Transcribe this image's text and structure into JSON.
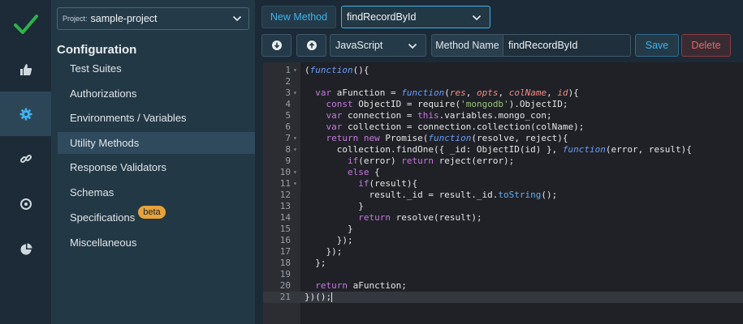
{
  "project": {
    "label": "Project:",
    "value": "sample-project"
  },
  "nav": {
    "title": "Configuration",
    "items": [
      {
        "label": "Test Suites"
      },
      {
        "label": "Authorizations"
      },
      {
        "label": "Environments / Variables"
      },
      {
        "label": "Utility Methods",
        "active": true
      },
      {
        "label": "Response Validators"
      },
      {
        "label": "Schemas"
      },
      {
        "label": "Specifications",
        "badge": "beta"
      },
      {
        "label": "Miscellaneous"
      }
    ]
  },
  "rail": {
    "icons": [
      "checkmark-icon",
      "thumbs-up-icon",
      "gear-icon",
      "link-icon",
      "target-icon",
      "pie-chart-icon"
    ],
    "active": "gear-icon",
    "accent": "#2fb34a"
  },
  "toolbar": {
    "new_method_label": "New Method",
    "method_select_value": "findRecordById",
    "language_value": "JavaScript",
    "method_name_label": "Method Name",
    "method_name_value": "findRecordById",
    "save_label": "Save",
    "delete_label": "Delete"
  },
  "editor": {
    "active_line": 21,
    "lines": [
      "(function(){",
      "",
      "  var aFunction = function(res, opts, colName, id){",
      "    const ObjectID = require('mongodb').ObjectID;",
      "    var connection = this.variables.mongo_con;",
      "    var collection = connection.collection(colName);",
      "    return new Promise(function(resolve, reject){",
      "      collection.findOne({ _id: ObjectID(id) }, function(error, result){",
      "        if(error) return reject(error);",
      "        else {",
      "          if(result){",
      "            result._id = result._id.toString();",
      "          }",
      "          return resolve(result);",
      "        }",
      "      });",
      "    });",
      "  };",
      "",
      "  return aFunction;",
      "})();"
    ],
    "folds": [
      1,
      3,
      7,
      8,
      10,
      11
    ]
  }
}
